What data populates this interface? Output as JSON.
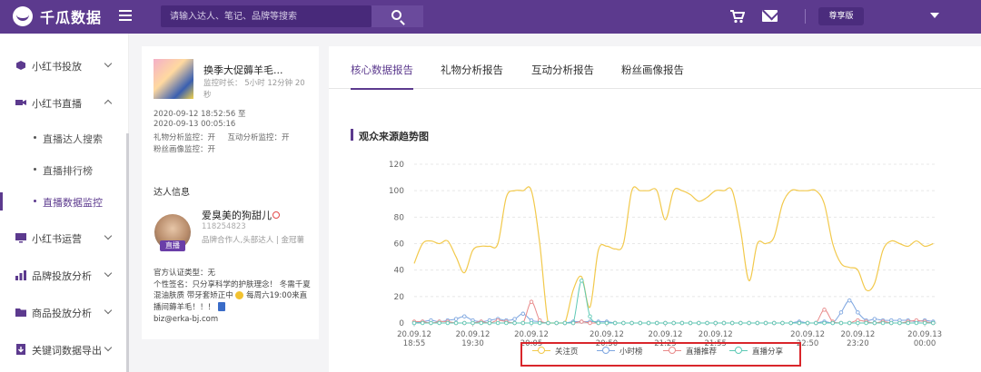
{
  "header": {
    "logo_text": "千瓜数据",
    "search_placeholder": "请输入达人、笔记、品牌等搜索",
    "plan_label": "尊享版"
  },
  "sidebar": {
    "items": [
      {
        "label": "小红书投放",
        "icon": "cube-icon",
        "state": "collapsed"
      },
      {
        "label": "小红书直播",
        "icon": "video-icon",
        "state": "expanded"
      },
      {
        "label": "小红书运营",
        "icon": "monitor-icon",
        "state": "collapsed"
      },
      {
        "label": "品牌投放分析",
        "icon": "bar-chart-icon",
        "state": "collapsed"
      },
      {
        "label": "商品投放分析",
        "icon": "folder-icon",
        "state": "collapsed"
      },
      {
        "label": "关键词数据导出",
        "icon": "download-icon",
        "state": "collapsed"
      }
    ],
    "live_sub": [
      {
        "label": "直播达人搜索",
        "active": false
      },
      {
        "label": "直播排行榜",
        "active": false
      },
      {
        "label": "直播数据监控",
        "active": true
      }
    ]
  },
  "live": {
    "title": "换季大促薅羊毛...",
    "duration": "监控时长： 5小时 12分钟 20秒",
    "time_range_start": "2020-09-12 18:52:56 至",
    "time_range_end": "2020-09-13 00:05:16",
    "monitor_line1": "礼物分析监控：开     互动分析监控：开",
    "monitor_line2": "粉丝画像监控：开"
  },
  "kol": {
    "section_title": "达人信息",
    "name": "爱臭美的狗甜儿",
    "id": "118254823",
    "tags": "品牌合作人,头部达人    | 金冠薯",
    "live_badge": "直播",
    "verify": "官方认证类型：无",
    "bio_1": "个性签名：只分享科学的护肤理念！ 冬需千夏混油肤质 带牙套矫正中",
    "bio_2": "每周六19:00来直播间薅羊毛！！！",
    "email": "biz@erka-bj.com"
  },
  "tabs": [
    {
      "label": "核心数据报告",
      "active": true
    },
    {
      "label": "礼物分析报告",
      "active": false
    },
    {
      "label": "互动分析报告",
      "active": false
    },
    {
      "label": "粉丝画像报告",
      "active": false
    }
  ],
  "chart_section_title": "观众来源趋势图",
  "chart_data": {
    "type": "line",
    "title": "观众来源趋势图",
    "xlabel": "",
    "ylabel": "",
    "ylim": [
      0,
      120
    ],
    "yticks": [
      0,
      20,
      40,
      60,
      80,
      100,
      120
    ],
    "x_min": 0,
    "x_max": 312,
    "xticks": [
      {
        "at": 0,
        "line1": "20.09.12",
        "line2": "18:55"
      },
      {
        "at": 35,
        "line1": "20.09.12",
        "line2": "19:30"
      },
      {
        "at": 70,
        "line1": "20.09.12",
        "line2": "20:05"
      },
      {
        "at": 115,
        "line1": "20.09.12",
        "line2": "20:50"
      },
      {
        "at": 150,
        "line1": "20.09.12",
        "line2": "21:25"
      },
      {
        "at": 180,
        "line1": "20.09.12",
        "line2": "21:55"
      },
      {
        "at": 235,
        "line1": "20.09.12",
        "line2": "22:50"
      },
      {
        "at": 265,
        "line1": "20.09.12",
        "line2": "23:20"
      },
      {
        "at": 305,
        "line1": "20.09.13",
        "line2": "00:00"
      }
    ],
    "grid": true,
    "legend": "bottom",
    "series": [
      {
        "name": "关注页",
        "color": "#f2c94c",
        "points": [
          [
            0,
            45
          ],
          [
            5,
            60
          ],
          [
            10,
            62
          ],
          [
            15,
            60
          ],
          [
            20,
            62
          ],
          [
            25,
            50
          ],
          [
            30,
            38
          ],
          [
            35,
            55
          ],
          [
            40,
            58
          ],
          [
            45,
            58
          ],
          [
            50,
            60
          ],
          [
            55,
            95
          ],
          [
            60,
            100
          ],
          [
            65,
            100
          ],
          [
            70,
            100
          ],
          [
            75,
            60
          ],
          [
            80,
            0
          ],
          [
            85,
            0
          ],
          [
            90,
            0
          ],
          [
            95,
            25
          ],
          [
            100,
            35
          ],
          [
            105,
            12
          ],
          [
            110,
            55
          ],
          [
            115,
            58
          ],
          [
            120,
            56
          ],
          [
            125,
            60
          ],
          [
            130,
            100
          ],
          [
            135,
            100
          ],
          [
            140,
            100
          ],
          [
            145,
            100
          ],
          [
            150,
            78
          ],
          [
            155,
            100
          ],
          [
            160,
            100
          ],
          [
            165,
            97
          ],
          [
            170,
            92
          ],
          [
            175,
            95
          ],
          [
            180,
            100
          ],
          [
            185,
            100
          ],
          [
            190,
            100
          ],
          [
            195,
            70
          ],
          [
            200,
            32
          ],
          [
            205,
            60
          ],
          [
            210,
            60
          ],
          [
            215,
            65
          ],
          [
            220,
            90
          ],
          [
            225,
            100
          ],
          [
            230,
            100
          ],
          [
            235,
            100
          ],
          [
            240,
            100
          ],
          [
            245,
            90
          ],
          [
            250,
            60
          ],
          [
            255,
            45
          ],
          [
            260,
            42
          ],
          [
            265,
            40
          ],
          [
            270,
            25
          ],
          [
            275,
            30
          ],
          [
            280,
            55
          ],
          [
            285,
            62
          ],
          [
            290,
            60
          ],
          [
            295,
            58
          ],
          [
            300,
            62
          ],
          [
            305,
            58
          ],
          [
            310,
            60
          ]
        ]
      },
      {
        "name": "小时榜",
        "color": "#7ea6e0",
        "points": [
          [
            0,
            0
          ],
          [
            5,
            1
          ],
          [
            10,
            2
          ],
          [
            15,
            1
          ],
          [
            20,
            2
          ],
          [
            25,
            3
          ],
          [
            30,
            5
          ],
          [
            35,
            2
          ],
          [
            40,
            1
          ],
          [
            45,
            2
          ],
          [
            50,
            3
          ],
          [
            55,
            2
          ],
          [
            60,
            3
          ],
          [
            65,
            7
          ],
          [
            70,
            2
          ],
          [
            75,
            1
          ],
          [
            80,
            0
          ],
          [
            85,
            0
          ],
          [
            90,
            0
          ],
          [
            95,
            1
          ],
          [
            100,
            1
          ],
          [
            105,
            1
          ],
          [
            110,
            1
          ],
          [
            115,
            1
          ],
          [
            120,
            0
          ],
          [
            125,
            0
          ],
          [
            130,
            0
          ],
          [
            135,
            0
          ],
          [
            140,
            0
          ],
          [
            145,
            0
          ],
          [
            150,
            0
          ],
          [
            155,
            0
          ],
          [
            160,
            0
          ],
          [
            165,
            0
          ],
          [
            170,
            0
          ],
          [
            175,
            0
          ],
          [
            180,
            0
          ],
          [
            185,
            0
          ],
          [
            190,
            0
          ],
          [
            195,
            0
          ],
          [
            200,
            0
          ],
          [
            205,
            0
          ],
          [
            210,
            0
          ],
          [
            215,
            0
          ],
          [
            220,
            0
          ],
          [
            225,
            0
          ],
          [
            230,
            1
          ],
          [
            235,
            0
          ],
          [
            240,
            0
          ],
          [
            245,
            1
          ],
          [
            250,
            0
          ],
          [
            255,
            8
          ],
          [
            260,
            17
          ],
          [
            265,
            8
          ],
          [
            270,
            2
          ],
          [
            275,
            3
          ],
          [
            280,
            2
          ],
          [
            285,
            2
          ],
          [
            290,
            2
          ],
          [
            295,
            2
          ],
          [
            300,
            1
          ],
          [
            305,
            2
          ],
          [
            310,
            1
          ]
        ]
      },
      {
        "name": "直播推荐",
        "color": "#e88a8a",
        "points": [
          [
            0,
            1
          ],
          [
            5,
            1
          ],
          [
            10,
            0
          ],
          [
            15,
            1
          ],
          [
            20,
            1
          ],
          [
            25,
            0
          ],
          [
            30,
            0
          ],
          [
            35,
            0
          ],
          [
            40,
            1
          ],
          [
            45,
            0
          ],
          [
            50,
            2
          ],
          [
            55,
            1
          ],
          [
            60,
            0
          ],
          [
            65,
            0
          ],
          [
            70,
            16
          ],
          [
            75,
            2
          ],
          [
            80,
            0
          ],
          [
            85,
            0
          ],
          [
            90,
            0
          ],
          [
            95,
            0
          ],
          [
            100,
            1
          ],
          [
            105,
            0
          ],
          [
            110,
            0
          ],
          [
            115,
            0
          ],
          [
            120,
            0
          ],
          [
            125,
            0
          ],
          [
            130,
            0
          ],
          [
            135,
            0
          ],
          [
            140,
            0
          ],
          [
            145,
            0
          ],
          [
            150,
            0
          ],
          [
            155,
            0
          ],
          [
            160,
            0
          ],
          [
            165,
            0
          ],
          [
            170,
            0
          ],
          [
            175,
            0
          ],
          [
            180,
            0
          ],
          [
            185,
            0
          ],
          [
            190,
            0
          ],
          [
            195,
            0
          ],
          [
            200,
            0
          ],
          [
            205,
            0
          ],
          [
            210,
            0
          ],
          [
            215,
            0
          ],
          [
            220,
            0
          ],
          [
            225,
            0
          ],
          [
            230,
            0
          ],
          [
            235,
            0
          ],
          [
            240,
            0
          ],
          [
            245,
            10
          ],
          [
            250,
            1
          ],
          [
            255,
            0
          ],
          [
            260,
            0
          ],
          [
            265,
            2
          ],
          [
            270,
            1
          ],
          [
            275,
            0
          ],
          [
            280,
            1
          ],
          [
            285,
            0
          ],
          [
            290,
            0
          ],
          [
            295,
            1
          ],
          [
            300,
            2
          ],
          [
            305,
            1
          ],
          [
            310,
            0
          ]
        ]
      },
      {
        "name": "直播分享",
        "color": "#5ec9b5",
        "points": [
          [
            0,
            0
          ],
          [
            5,
            0
          ],
          [
            10,
            0
          ],
          [
            15,
            0
          ],
          [
            20,
            0
          ],
          [
            25,
            0
          ],
          [
            30,
            0
          ],
          [
            35,
            0
          ],
          [
            40,
            0
          ],
          [
            45,
            0
          ],
          [
            50,
            0
          ],
          [
            55,
            0
          ],
          [
            60,
            0
          ],
          [
            65,
            0
          ],
          [
            70,
            0
          ],
          [
            75,
            0
          ],
          [
            80,
            0
          ],
          [
            85,
            0
          ],
          [
            90,
            0
          ],
          [
            95,
            0
          ],
          [
            100,
            32
          ],
          [
            105,
            5
          ],
          [
            110,
            0
          ],
          [
            115,
            0
          ],
          [
            120,
            0
          ],
          [
            125,
            0
          ],
          [
            130,
            0
          ],
          [
            135,
            0
          ],
          [
            140,
            0
          ],
          [
            145,
            0
          ],
          [
            150,
            0
          ],
          [
            155,
            0
          ],
          [
            160,
            0
          ],
          [
            165,
            0
          ],
          [
            170,
            0
          ],
          [
            175,
            0
          ],
          [
            180,
            0
          ],
          [
            185,
            0
          ],
          [
            190,
            0
          ],
          [
            195,
            0
          ],
          [
            200,
            0
          ],
          [
            205,
            0
          ],
          [
            210,
            0
          ],
          [
            215,
            0
          ],
          [
            220,
            0
          ],
          [
            225,
            0
          ],
          [
            230,
            0
          ],
          [
            235,
            0
          ],
          [
            240,
            0
          ],
          [
            245,
            0
          ],
          [
            250,
            0
          ],
          [
            255,
            0
          ],
          [
            260,
            0
          ],
          [
            265,
            0
          ],
          [
            270,
            0
          ],
          [
            275,
            0
          ],
          [
            280,
            0
          ],
          [
            285,
            0
          ],
          [
            290,
            0
          ],
          [
            295,
            0
          ],
          [
            300,
            0
          ],
          [
            305,
            0
          ],
          [
            310,
            0
          ]
        ]
      }
    ]
  }
}
